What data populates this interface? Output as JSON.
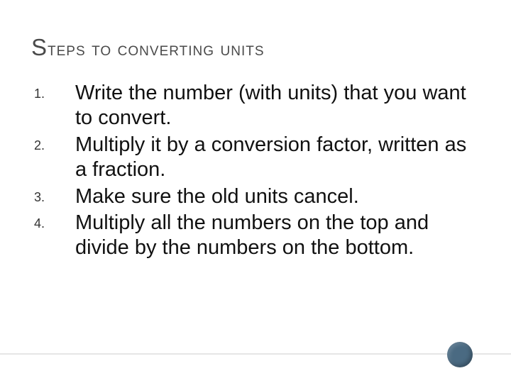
{
  "slide": {
    "title_cap": "S",
    "title_rest": "teps to converting units",
    "steps": [
      "Write the number (with units) that you want to convert.",
      "Multiply it by a conversion factor, written as a fraction.",
      "Make sure the old units cancel.",
      "Multiply all the numbers on the top and divide by the numbers on the bottom."
    ]
  }
}
